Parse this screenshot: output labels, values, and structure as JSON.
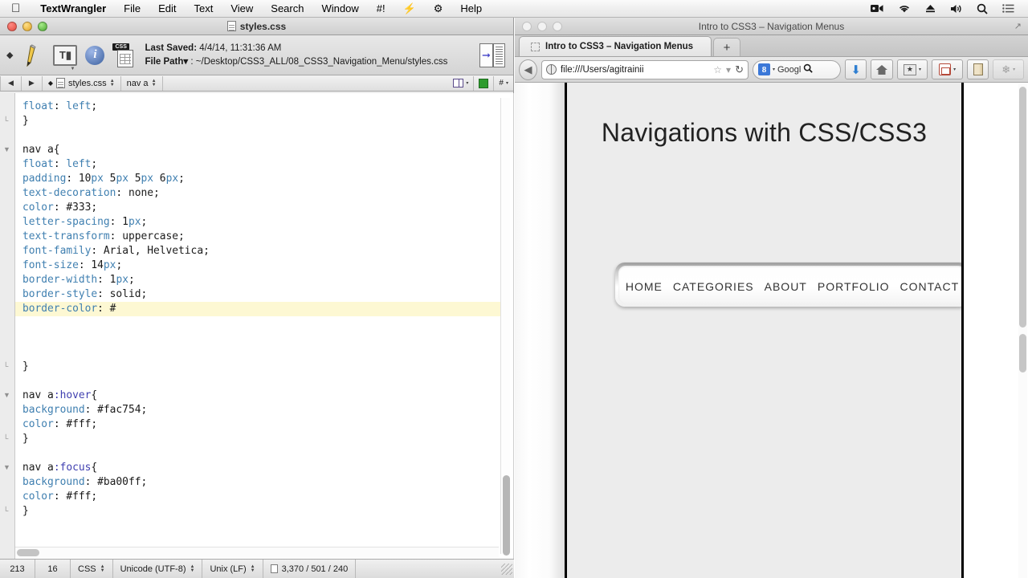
{
  "menubar": {
    "apple_icon": "apple-icon",
    "app_name": "TextWrangler",
    "items": [
      "File",
      "Edit",
      "Text",
      "View",
      "Search",
      "Window",
      "#!",
      "⚡",
      "⚙",
      "Help"
    ],
    "right_icons": [
      "video-camera-icon",
      "wifi-icon",
      "eject-icon",
      "volume-icon",
      "search-icon",
      "list-icon"
    ]
  },
  "textwrangler": {
    "title": "styles.css",
    "toolbar": {
      "last_saved_label": "Last Saved:",
      "last_saved_value": "4/4/14, 11:31:36 AM",
      "file_path_label": "File Path",
      "file_path_value": ": ~/Desktop/CSS3_ALL/08_CSS3_Navigation_Menu/styles.css"
    },
    "navbar": {
      "back": "◀",
      "forward": "▶",
      "file_name": "styles.css",
      "function_name": "nav a",
      "hash_label": "#"
    },
    "code_lines": [
      {
        "indent": 0,
        "tokens": [
          {
            "t": "float",
            "c": "prop"
          },
          {
            "t": ": ",
            "c": "punct"
          },
          {
            "t": "left",
            "c": "prop"
          },
          {
            "t": ";",
            "c": "punct"
          }
        ]
      },
      {
        "indent": 0,
        "tokens": [
          {
            "t": "}",
            "c": "punct"
          }
        ]
      },
      {
        "indent": 0,
        "tokens": []
      },
      {
        "indent": 0,
        "tokens": [
          {
            "t": "nav a{",
            "c": "sel"
          }
        ]
      },
      {
        "indent": 0,
        "tokens": [
          {
            "t": "float",
            "c": "prop"
          },
          {
            "t": ": ",
            "c": "punct"
          },
          {
            "t": "left",
            "c": "prop"
          },
          {
            "t": ";",
            "c": "punct"
          }
        ]
      },
      {
        "indent": 0,
        "tokens": [
          {
            "t": "padding",
            "c": "prop"
          },
          {
            "t": ": 10",
            "c": "val"
          },
          {
            "t": "px",
            "c": "prop"
          },
          {
            "t": " 5",
            "c": "val"
          },
          {
            "t": "px",
            "c": "prop"
          },
          {
            "t": " 5",
            "c": "val"
          },
          {
            "t": "px",
            "c": "prop"
          },
          {
            "t": " 6",
            "c": "val"
          },
          {
            "t": "px",
            "c": "prop"
          },
          {
            "t": ";",
            "c": "val"
          }
        ]
      },
      {
        "indent": 0,
        "tokens": [
          {
            "t": "text-decoration",
            "c": "prop"
          },
          {
            "t": ": ",
            "c": "punct"
          },
          {
            "t": "none",
            "c": "val"
          },
          {
            "t": ";",
            "c": "punct"
          }
        ]
      },
      {
        "indent": 0,
        "tokens": [
          {
            "t": "color",
            "c": "prop"
          },
          {
            "t": ": ",
            "c": "punct"
          },
          {
            "t": "#333;",
            "c": "val"
          }
        ]
      },
      {
        "indent": 0,
        "tokens": [
          {
            "t": "letter-spacing",
            "c": "prop"
          },
          {
            "t": ": 1",
            "c": "val"
          },
          {
            "t": "px",
            "c": "prop"
          },
          {
            "t": ";",
            "c": "val"
          }
        ]
      },
      {
        "indent": 0,
        "tokens": [
          {
            "t": "text-transform",
            "c": "prop"
          },
          {
            "t": ": ",
            "c": "punct"
          },
          {
            "t": "uppercase;",
            "c": "val"
          }
        ]
      },
      {
        "indent": 0,
        "tokens": [
          {
            "t": "font-family",
            "c": "prop"
          },
          {
            "t": ": ",
            "c": "punct"
          },
          {
            "t": "Arial, Helvetica;",
            "c": "val"
          }
        ]
      },
      {
        "indent": 0,
        "tokens": [
          {
            "t": "font-size",
            "c": "prop"
          },
          {
            "t": ": 14",
            "c": "val"
          },
          {
            "t": "px",
            "c": "prop"
          },
          {
            "t": ";",
            "c": "val"
          }
        ]
      },
      {
        "indent": 0,
        "tokens": [
          {
            "t": "border-width",
            "c": "prop"
          },
          {
            "t": ": 1",
            "c": "val"
          },
          {
            "t": "px",
            "c": "prop"
          },
          {
            "t": ";",
            "c": "val"
          }
        ]
      },
      {
        "indent": 0,
        "tokens": [
          {
            "t": "border-style",
            "c": "prop"
          },
          {
            "t": ": ",
            "c": "punct"
          },
          {
            "t": "solid;",
            "c": "val"
          }
        ]
      },
      {
        "indent": 0,
        "highlight": true,
        "tokens": [
          {
            "t": "border-color",
            "c": "prop"
          },
          {
            "t": ": ",
            "c": "punct"
          },
          {
            "t": "#",
            "c": "val"
          }
        ]
      },
      {
        "indent": 0,
        "tokens": []
      },
      {
        "indent": 0,
        "tokens": []
      },
      {
        "indent": 0,
        "tokens": []
      },
      {
        "indent": 0,
        "tokens": [
          {
            "t": "}",
            "c": "punct"
          }
        ]
      },
      {
        "indent": 0,
        "tokens": []
      },
      {
        "indent": 0,
        "tokens": [
          {
            "t": "nav a",
            "c": "sel"
          },
          {
            "t": ":hover",
            "c": "pseudo"
          },
          {
            "t": "{",
            "c": "punct"
          }
        ]
      },
      {
        "indent": 0,
        "tokens": [
          {
            "t": "background",
            "c": "prop"
          },
          {
            "t": ": ",
            "c": "punct"
          },
          {
            "t": "#fac754;",
            "c": "val"
          }
        ]
      },
      {
        "indent": 0,
        "tokens": [
          {
            "t": "color",
            "c": "prop"
          },
          {
            "t": ": ",
            "c": "punct"
          },
          {
            "t": "#fff;",
            "c": "val"
          }
        ]
      },
      {
        "indent": 0,
        "tokens": [
          {
            "t": "}",
            "c": "punct"
          }
        ]
      },
      {
        "indent": 0,
        "tokens": []
      },
      {
        "indent": 0,
        "tokens": [
          {
            "t": "nav a",
            "c": "sel"
          },
          {
            "t": ":focus",
            "c": "pseudo"
          },
          {
            "t": "{",
            "c": "punct"
          }
        ]
      },
      {
        "indent": 0,
        "tokens": [
          {
            "t": "background",
            "c": "prop"
          },
          {
            "t": ": ",
            "c": "punct"
          },
          {
            "t": "#ba00ff;",
            "c": "val"
          }
        ]
      },
      {
        "indent": 0,
        "tokens": [
          {
            "t": "color",
            "c": "prop"
          },
          {
            "t": ": ",
            "c": "punct"
          },
          {
            "t": "#fff;",
            "c": "val"
          }
        ]
      },
      {
        "indent": 0,
        "tokens": [
          {
            "t": "}",
            "c": "punct"
          }
        ]
      }
    ],
    "status": {
      "line": "213",
      "column": "16",
      "language": "CSS",
      "encoding": "Unicode (UTF-8)",
      "line_endings": "Unix (LF)",
      "counts": "3,370 / 501 / 240"
    }
  },
  "firefox": {
    "window_title": "Intro to CSS3 – Navigation Menus",
    "tab_title": "Intro to CSS3 – Navigation Menus",
    "newtab_label": "+",
    "url": "file:///Users/agitrainii",
    "search_engine": "Googl",
    "toolbar_icons": [
      "download-icon",
      "home-icon",
      "bookmarks-icon",
      "pocket-icon",
      "reader-list-icon",
      "tools-icon"
    ]
  },
  "page": {
    "heading": "Navigations with CSS/CSS3",
    "nav_items": [
      "HOME",
      "CATEGORIES",
      "ABOUT",
      "PORTFOLIO",
      "CONTACT"
    ]
  },
  "colors": {
    "highlight_line": "#fdf8d3",
    "css_property": "#3f7fb0",
    "css_pseudo": "#4040b0",
    "hover_bg": "#fac754",
    "focus_bg": "#ba00ff"
  }
}
